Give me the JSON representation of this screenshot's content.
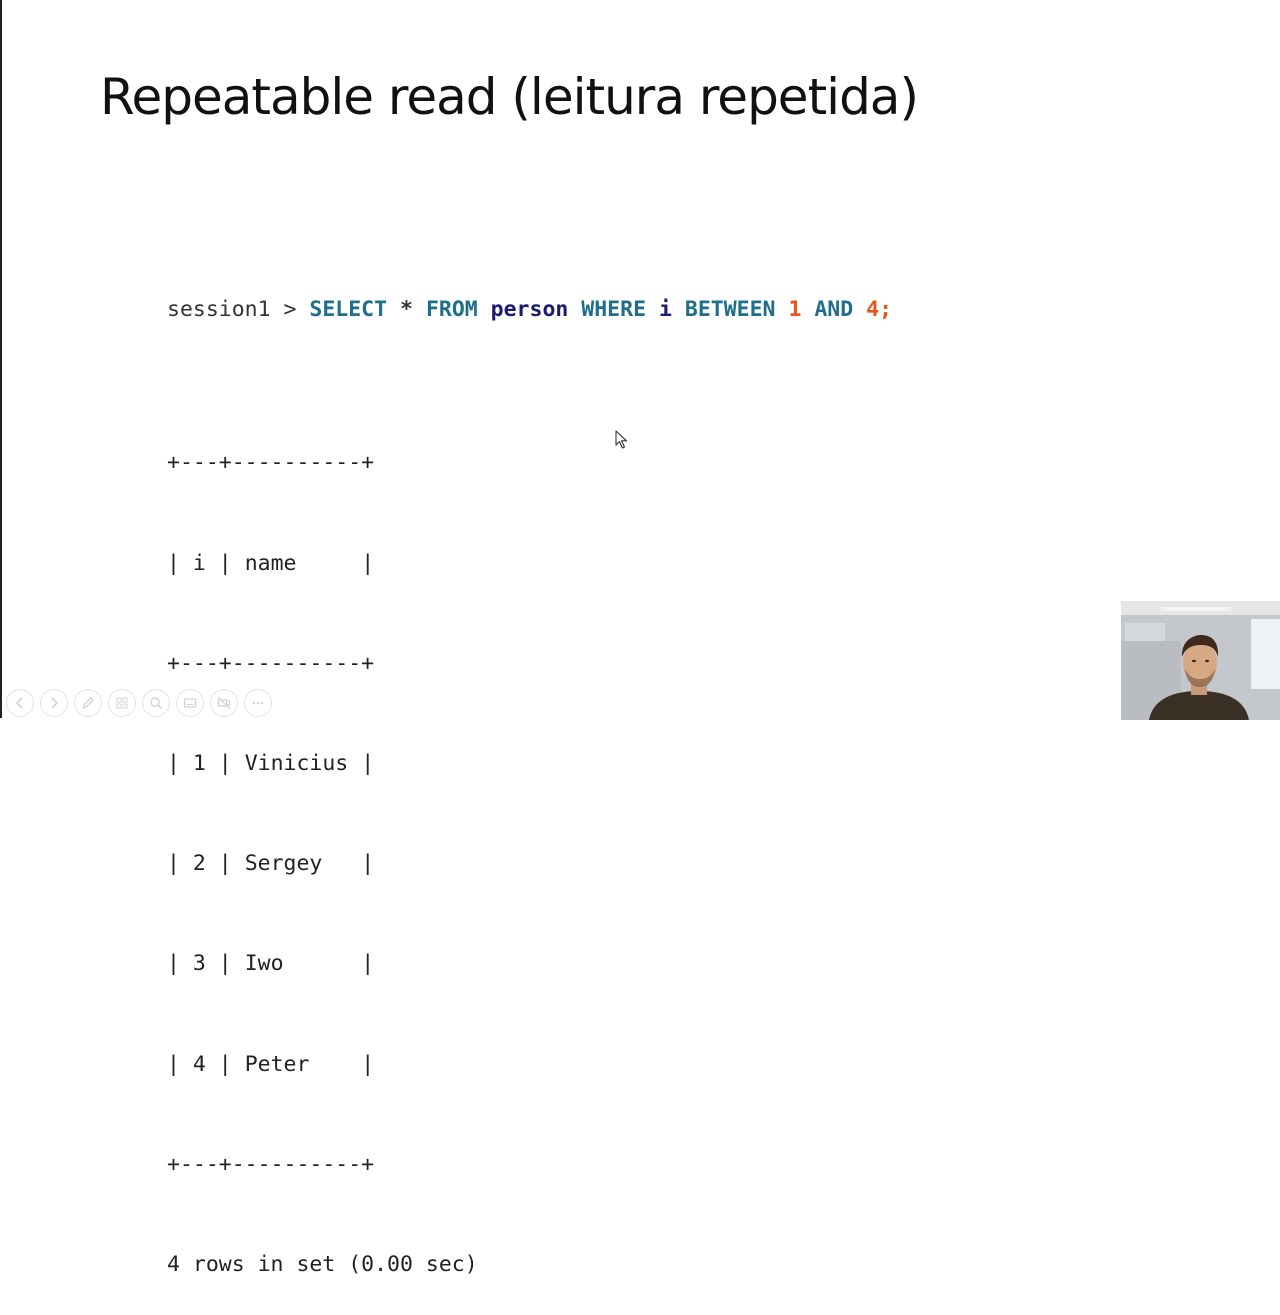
{
  "slide": {
    "title": "Repeatable read (leitura repetida)"
  },
  "query": {
    "prompt": "session1 >",
    "tokens": [
      {
        "text": "SELECT",
        "kind": "kw"
      },
      {
        "text": "*",
        "kind": "op"
      },
      {
        "text": "FROM",
        "kind": "kw"
      },
      {
        "text": "person",
        "kind": "ident"
      },
      {
        "text": "WHERE",
        "kind": "kw"
      },
      {
        "text": "i",
        "kind": "ident"
      },
      {
        "text": "BETWEEN",
        "kind": "kw"
      },
      {
        "text": "1",
        "kind": "num"
      },
      {
        "text": "AND",
        "kind": "kw"
      },
      {
        "text": "4;",
        "kind": "num"
      }
    ]
  },
  "result": {
    "border": "+---+----------+",
    "columns": [
      "i",
      "name"
    ],
    "rows": [
      [
        "1",
        "Vinicius"
      ],
      [
        "2",
        "Sergey"
      ],
      [
        "3",
        "Iwo"
      ],
      [
        "4",
        "Peter"
      ]
    ],
    "footer": "4 rows in set (0.00 sec)"
  },
  "toolbar": {
    "icons": [
      "previous-slide-icon",
      "next-slide-icon",
      "pen-icon",
      "slides-grid-icon",
      "zoom-icon",
      "subtitles-icon",
      "camera-off-icon",
      "more-options-icon"
    ]
  },
  "colors": {
    "keyword": "#1f6f8b",
    "identifier": "#1a1a6e",
    "number": "#e8541a"
  }
}
